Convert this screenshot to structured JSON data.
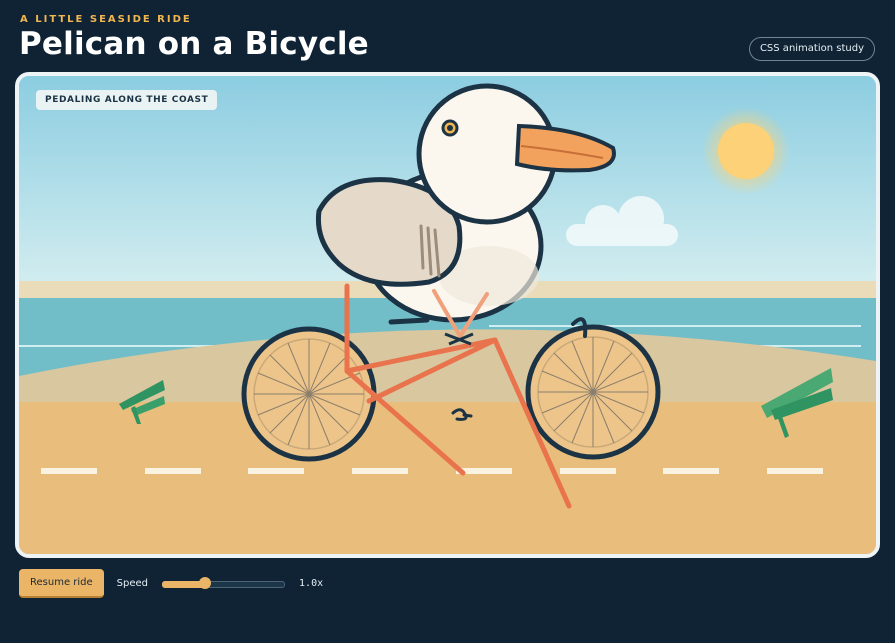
{
  "header": {
    "eyebrow": "A LITTLE SEASIDE RIDE",
    "title": "Pelican on a Bicycle",
    "badge": "CSS animation study"
  },
  "stage": {
    "label": "PEDALING ALONG THE COAST"
  },
  "controls": {
    "resume_label": "Resume ride",
    "speed_label": "Speed",
    "speed_value": "1.0x",
    "speed_fraction": 0.35
  },
  "colors": {
    "page_bg": "#0f2334",
    "accent": "#eab567",
    "eyebrow": "#f2b650",
    "sky_top": "#8fcfe2",
    "sea": "#6fbcc6",
    "road": "#e9bd7c",
    "bike_frame": "#e8734d",
    "outline": "#1b3344"
  }
}
